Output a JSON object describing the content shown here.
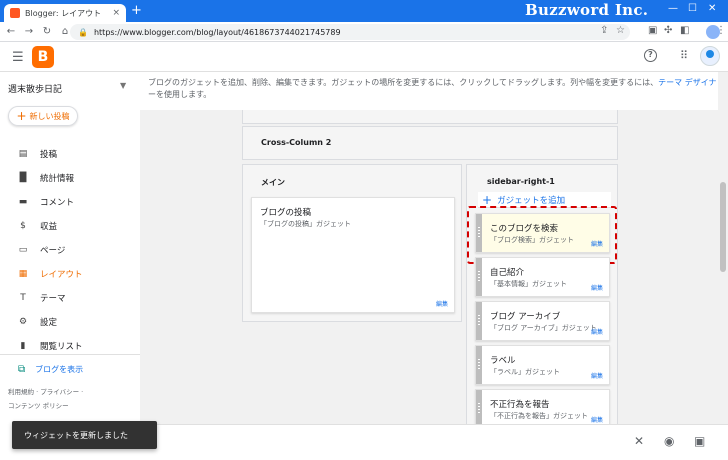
{
  "browser": {
    "tab_title": "Blogger: レイアウト",
    "tab_close": "×",
    "new_tab": "+",
    "brand": "Buzzword Inc.",
    "url": "https://www.blogger.com/blog/layout/4618673744021745789"
  },
  "header": {
    "logo_letter": "B",
    "help": "?"
  },
  "sidebar": {
    "blog_name": "週末散歩日記",
    "new_post": "新しい投稿",
    "items": [
      {
        "label": "投稿",
        "icon": "▤"
      },
      {
        "label": "統計情報",
        "icon": "📊"
      },
      {
        "label": "コメント",
        "icon": "▬"
      },
      {
        "label": "収益",
        "icon": "$"
      },
      {
        "label": "ページ",
        "icon": "▭"
      },
      {
        "label": "レイアウト",
        "icon": "▦"
      },
      {
        "label": "テーマ",
        "icon": "T"
      },
      {
        "label": "設定",
        "icon": "⚙"
      },
      {
        "label": "閲覧リスト",
        "icon": "▮"
      }
    ],
    "view_blog": "ブログを表示",
    "footer_1": "利用規約 · プライバシー ·",
    "footer_2": "コンテンツ ポリシー"
  },
  "main": {
    "info_text": "ブログのガジェットを追加、削除、編集できます。ガジェットの場所を変更するには、クリックしてドラッグします。列や幅を変更するには、",
    "info_link": "テーマ デザイナ",
    "info_tail": "ーを使用します。",
    "cross_column": "Cross-Column 2",
    "main_col": {
      "header": "メイン",
      "gadget_title": "ブログの投稿",
      "gadget_sub": "「ブログの投稿」ガジェット",
      "edit": "編集"
    },
    "sidebar_col": {
      "header": "sidebar-right-1",
      "add_gadget": "ガジェットを追加",
      "gadgets": [
        {
          "title": "このブログを検索",
          "sub": "「ブログ検索」ガジェット",
          "edit": "編集"
        },
        {
          "title": "自己紹介",
          "sub": "「基本情報」ガジェット",
          "edit": "編集"
        },
        {
          "title": "ブログ アーカイブ",
          "sub": "「ブログ アーカイブ」ガジェット",
          "edit": "編集"
        },
        {
          "title": "ラベル",
          "sub": "「ラベル」ガジェット",
          "edit": "編集"
        },
        {
          "title": "不正行為を報告",
          "sub": "「不正行為を報告」ガジェット",
          "edit": "編集"
        }
      ]
    }
  },
  "toast": "ウィジェットを更新しました",
  "colors": {
    "accent": "#ef6c00",
    "link": "#1a73e8",
    "highlight_border": "#d50000",
    "selected_gadget": "#fffde7"
  }
}
